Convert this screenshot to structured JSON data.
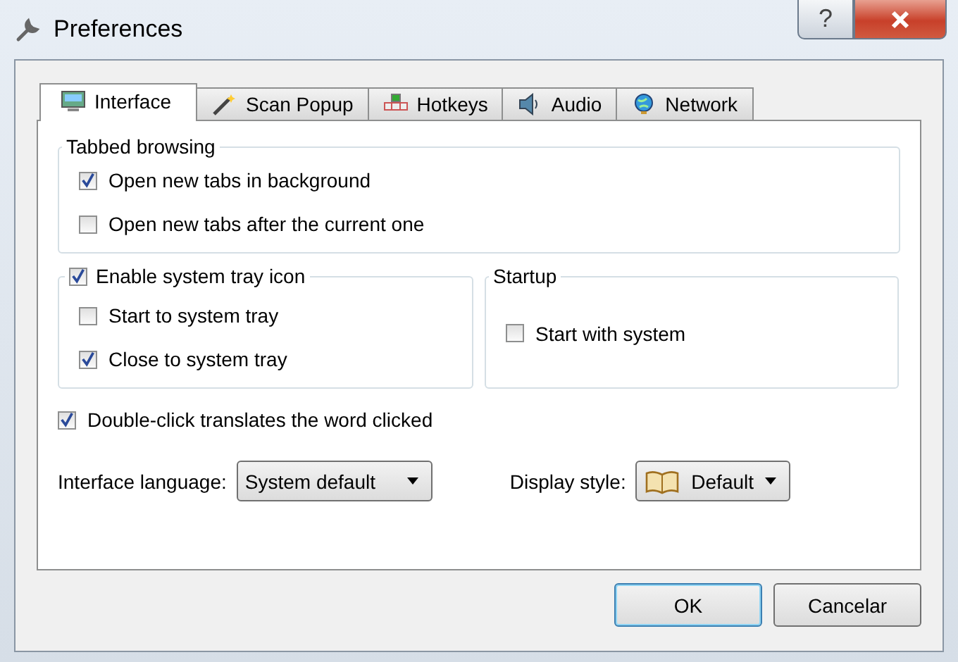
{
  "window": {
    "title": "Preferences",
    "help_button": "?"
  },
  "tabs": [
    {
      "label": "Interface",
      "selected": true
    },
    {
      "label": "Scan Popup",
      "selected": false
    },
    {
      "label": "Hotkeys",
      "selected": false
    },
    {
      "label": "Audio",
      "selected": false
    },
    {
      "label": "Network",
      "selected": false
    }
  ],
  "tabbed_browsing": {
    "title": "Tabbed browsing",
    "options": [
      {
        "label": "Open new tabs in background",
        "checked": true
      },
      {
        "label": "Open new tabs after the current one",
        "checked": false
      }
    ]
  },
  "system_tray": {
    "title": "Enable system tray icon",
    "checked": true,
    "options": [
      {
        "label": "Start to system tray",
        "checked": false
      },
      {
        "label": "Close to system tray",
        "checked": true
      }
    ]
  },
  "startup": {
    "title": "Startup",
    "options": [
      {
        "label": "Start with system",
        "checked": false
      }
    ]
  },
  "double_click": {
    "label": "Double-click translates the word clicked",
    "checked": true
  },
  "interface_language": {
    "label": "Interface language:",
    "value": "System default"
  },
  "display_style": {
    "label": "Display style:",
    "value": "Default"
  },
  "buttons": [
    {
      "label": "OK",
      "default": true
    },
    {
      "label": "Cancelar",
      "default": false
    }
  ]
}
